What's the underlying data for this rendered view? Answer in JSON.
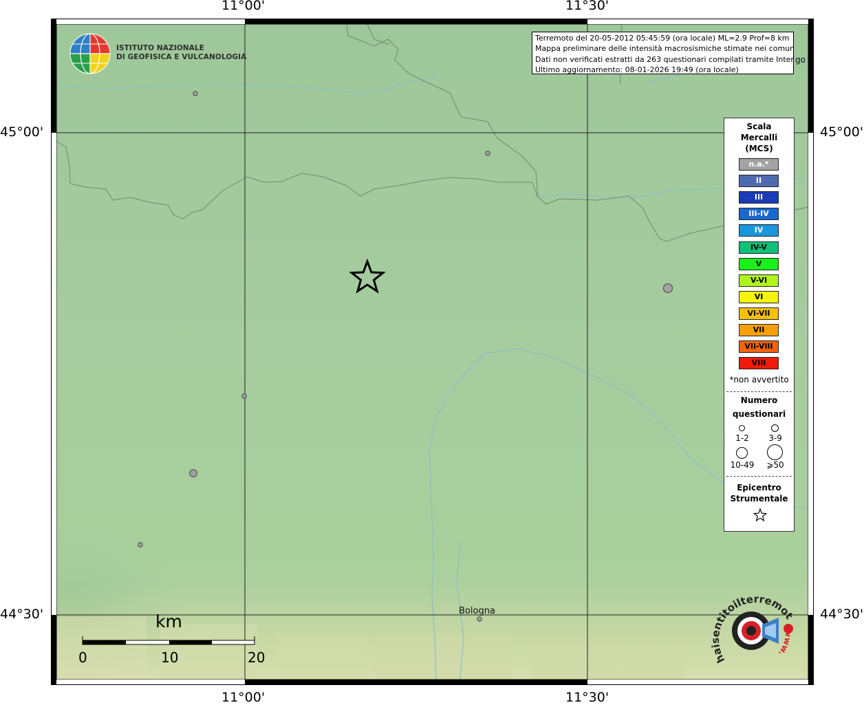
{
  "coords": {
    "top_left": "11°00'",
    "top_right": "11°30'",
    "bottom_left": "11°00'",
    "bottom_right": "11°30'",
    "left_top": "45°00'",
    "left_bottom": "44°30'",
    "right_top": "45°00'",
    "right_bottom": "44°30'"
  },
  "logo": {
    "line1": "ISTITUTO NAZIONALE",
    "line2": "DI GEOFISICA E VULCANOLOGIA"
  },
  "info": {
    "line1": "Terremoto del 20-05-2012 05:45:59 (ora locale) ML=2.9 Prof=8 km",
    "line2": "Mappa preliminare delle intensità macrosismiche stimate nei comuni",
    "line3": "Dati non verificati estratti da 263 questionari compilati tramite Internet",
    "line4": "Ultimo aggiornamento: 08-01-2026 19:49 (ora locale)",
    "overflow": "go"
  },
  "legend": {
    "title1": "Scala",
    "title2": "Mercalli",
    "title3": "(MCS)",
    "items": [
      {
        "label": "n.a.*",
        "color": "#a3a3a3"
      },
      {
        "label": "II",
        "color": "#4f6bb0"
      },
      {
        "label": "III",
        "color": "#1a3cb8"
      },
      {
        "label": "III-IV",
        "color": "#1868d0"
      },
      {
        "label": "IV",
        "color": "#1a96dc"
      },
      {
        "label": "IV-V",
        "color": "#0ec078"
      },
      {
        "label": "V",
        "color": "#1af01a"
      },
      {
        "label": "V-VI",
        "color": "#b0f51a"
      },
      {
        "label": "VI",
        "color": "#f5f50a"
      },
      {
        "label": "VI-VII",
        "color": "#f5c00a"
      },
      {
        "label": "VII",
        "color": "#f5a00a"
      },
      {
        "label": "VII-VIII",
        "color": "#f0640a"
      },
      {
        "label": "VIII",
        "color": "#f01a0a"
      }
    ],
    "note": "*non avvertito",
    "count_title1": "Numero",
    "count_title2": "questionari",
    "counts": [
      "1-2",
      "3-9",
      "10-49",
      "⩾50"
    ],
    "epi1": "Epicentro",
    "epi2": "Strumentale"
  },
  "city": "Bologna",
  "scale": {
    "unit": "km",
    "ticks": [
      "0",
      "10",
      "20"
    ]
  },
  "brand_logo": {
    "text1": "haisentitoilterremoto.it",
    "text2": "www."
  }
}
